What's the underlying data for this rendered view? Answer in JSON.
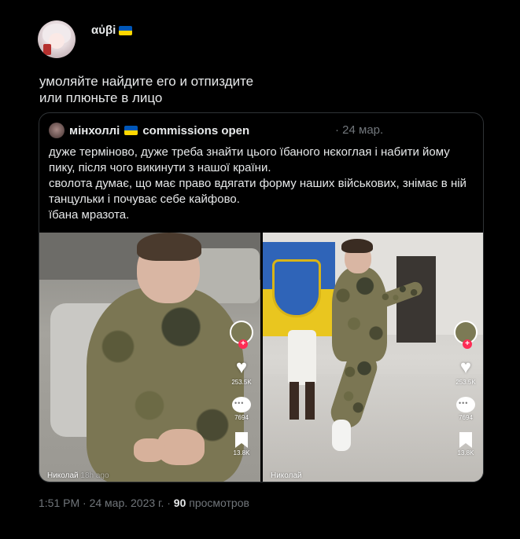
{
  "tweet": {
    "author": "αὐβi",
    "flag": "ukraine-flag-icon",
    "text": "умоляйте найдите его и отпиздите\nили плюньте в лицо"
  },
  "quote": {
    "author": "мінхоллі",
    "flag": "ukraine-flag-icon",
    "author_suffix": "commissions open",
    "date": "· 24 мар.",
    "text": "дуже терміново, дуже треба знайти цього їбаного нєкоглая і набити йому пику, після чого викинути з нашої країни.\nсволота думає, що має право вдягати форму наших військових, знімає в ній танцульки і почуває себе кайфово.\nїбана мразота.",
    "media": [
      {
        "watermark_name": "Николай",
        "watermark_extra": "18h ago",
        "likes": "253.5K",
        "comments": "7694",
        "saves": "13.8K"
      },
      {
        "watermark_name": "Николай",
        "watermark_extra": "",
        "likes": "253.5K",
        "comments": "7694",
        "saves": "13.8K"
      }
    ]
  },
  "meta": {
    "time": "1:51 PM · 24 мар. 2023 г. · ",
    "views": "90",
    "views_label": " просмотров"
  },
  "colors": {
    "background": "#000000",
    "text": "#e7e9ea",
    "secondary": "#71767b",
    "border": "#2f3336",
    "tiktok_red": "#fe2c55"
  }
}
